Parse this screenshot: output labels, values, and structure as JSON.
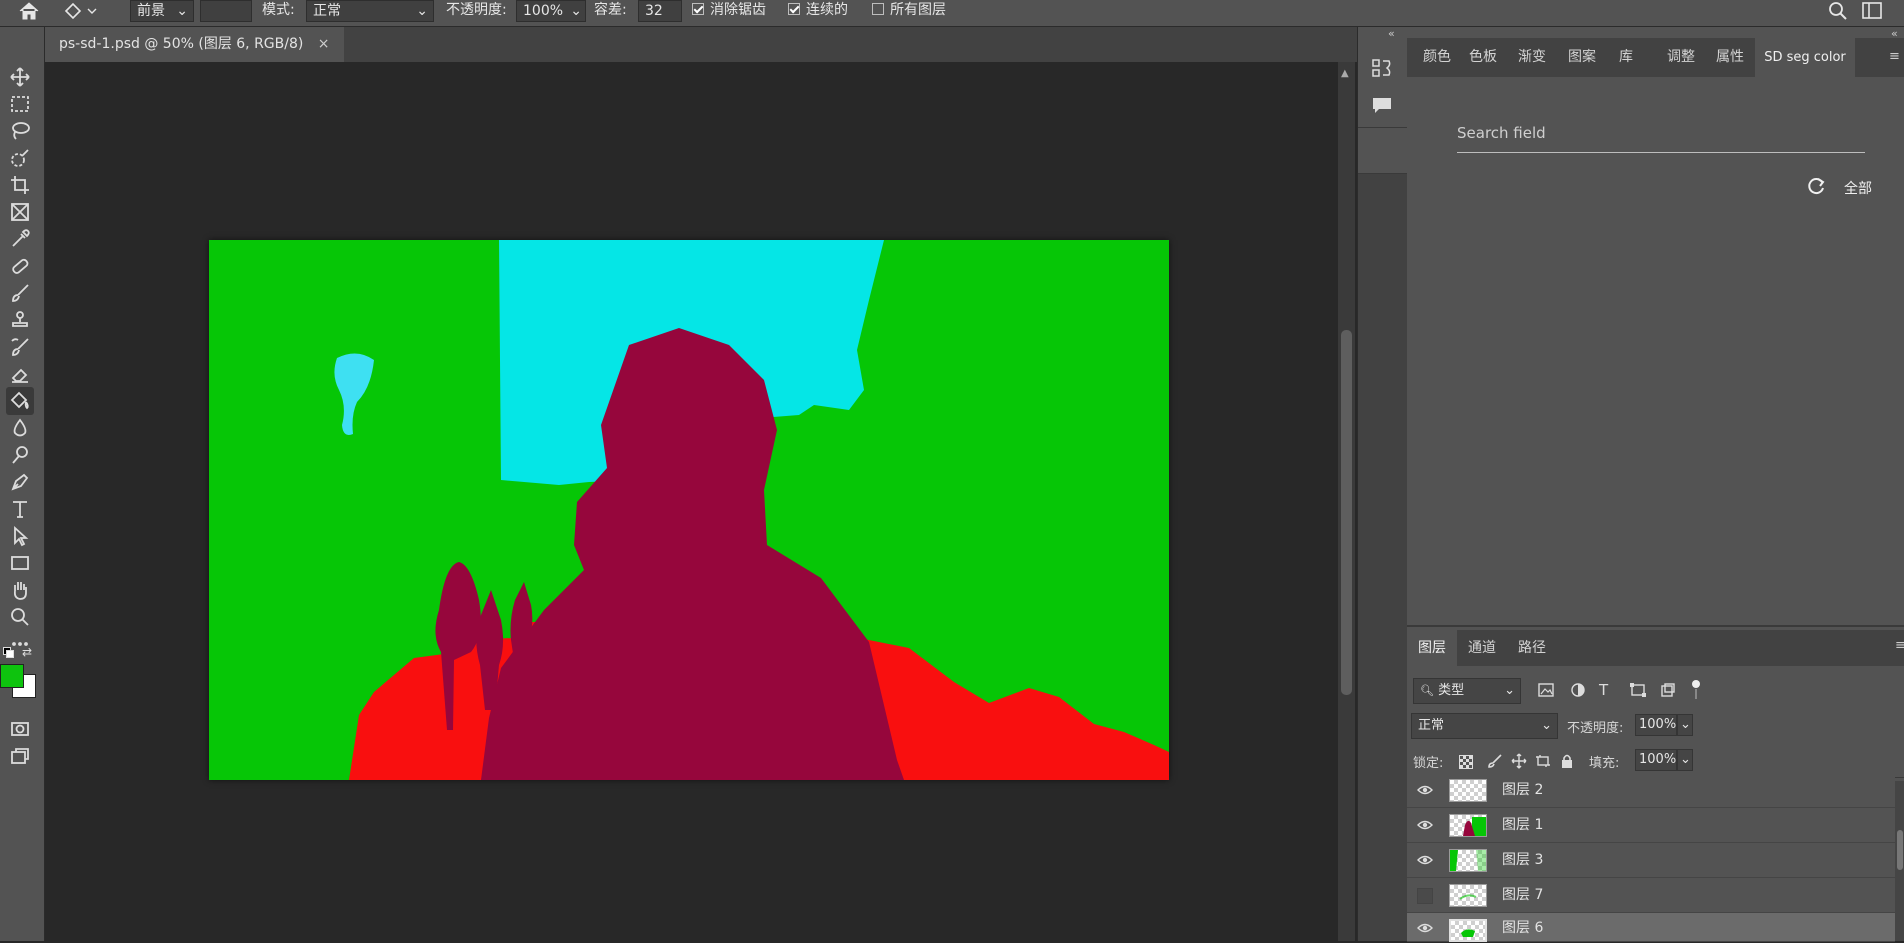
{
  "options_bar": {
    "fill_source": "前景",
    "mode_label": "模式:",
    "mode_value": "正常",
    "opacity_label": "不透明度:",
    "opacity_value": "100%",
    "tolerance_label": "容差:",
    "tolerance_value": "32",
    "antialias_label": "消除锯齿",
    "antialias_checked": true,
    "contiguous_label": "连续的",
    "contiguous_checked": true,
    "all_layers_label": "所有图层",
    "all_layers_checked": false
  },
  "document_tab": {
    "title": "ps-sd-1.psd @ 50% (图层 6, RGB/8)",
    "close": "×"
  },
  "toolbar": {
    "tools": [
      "move",
      "marquee",
      "lasso",
      "quick-select",
      "crop",
      "frame",
      "eyedropper",
      "healing",
      "brush",
      "stamp",
      "history-brush",
      "eraser",
      "paint-bucket",
      "blur",
      "dodge",
      "pen",
      "type",
      "path-select",
      "rectangle",
      "hand",
      "zoom",
      "more"
    ],
    "active_tool": "paint-bucket",
    "foreground_color": "#0ec30e",
    "background_color": "#ffffff"
  },
  "canvas": {
    "colors": {
      "vegetation": "#06c606",
      "sky": "#05e6e6",
      "person": "#96063c",
      "ground": "#f90f0f",
      "water": "#3ee0f2"
    }
  },
  "top_panel": {
    "tabs": [
      "颜色",
      "色板",
      "渐变",
      "图案",
      "库",
      "调整",
      "属性",
      "SD seg color"
    ],
    "selected_tab": "SD seg color",
    "search_placeholder": "Search field",
    "all_label": "全部"
  },
  "layers_panel": {
    "tabs": [
      "图层",
      "通道",
      "路径"
    ],
    "selected_tab": "图层",
    "filter_label": "类型",
    "blend_mode": "正常",
    "opacity_label": "不透明度:",
    "opacity_value": "100%",
    "lock_label": "锁定:",
    "fill_label": "填充:",
    "fill_value": "100%",
    "layers": [
      {
        "name": "图层 2",
        "visible": true,
        "selected": false
      },
      {
        "name": "图层 1",
        "visible": true,
        "selected": false
      },
      {
        "name": "图层 3",
        "visible": true,
        "selected": false
      },
      {
        "name": "图层 7",
        "visible": false,
        "selected": false
      },
      {
        "name": "图层 6",
        "visible": true,
        "selected": true
      }
    ]
  }
}
